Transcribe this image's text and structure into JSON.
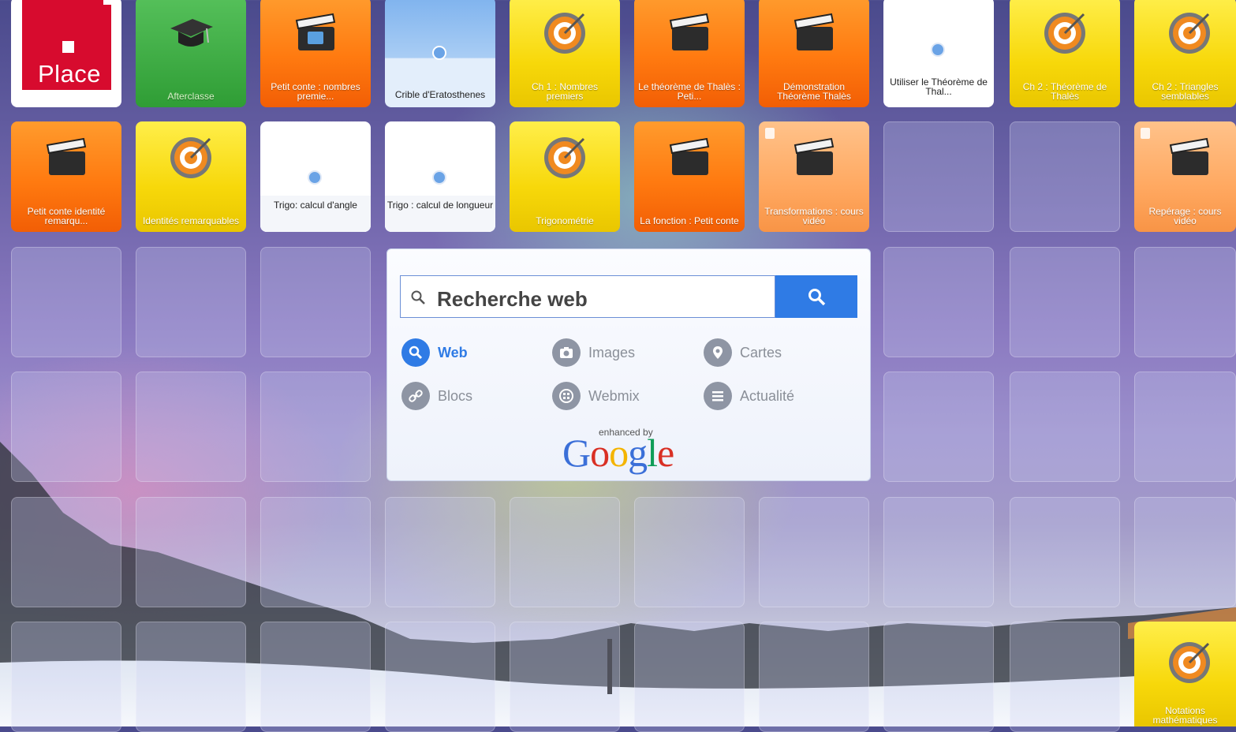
{
  "colors": {
    "accent": "#2f7be5",
    "tile_orange": "#ff7a10",
    "tile_yellow": "#f7d80a",
    "tile_green": "#2f9d35",
    "place_red": "#d70b2e"
  },
  "tiles": {
    "place": {
      "text": "Place",
      "icon": "place-logo"
    },
    "afterclasse": {
      "label": "Afterclasse",
      "icon": "graduation-cap-icon"
    },
    "petit_conte_nombres": {
      "label": "Petit conte : nombres premie...",
      "icon": "clapperboard-icon"
    },
    "crible": {
      "label": "Crible d'Eratosthenes",
      "icon": "globe-icon"
    },
    "ch1_nombres": {
      "label": "Ch 1 : Nombres premiers",
      "icon": "target-icon"
    },
    "theoreme_thales_conte": {
      "label": "Le théorème de Thalès : Peti...",
      "icon": "clapperboard-icon"
    },
    "demonstration_thales": {
      "label": "Démonstration Théorème Thalès",
      "icon": "clapperboard-icon"
    },
    "utiliser_thales": {
      "label": "Utiliser le Théorème de Thal...",
      "icon": "globe-icon"
    },
    "ch2_thales": {
      "label": "Ch 2 : Théorème de Thalès",
      "icon": "target-icon"
    },
    "ch2_triangles": {
      "label": "Ch 2 : Triangles semblables",
      "icon": "target-icon"
    },
    "petit_conte_identite": {
      "label": "Petit conte identité remarqu...",
      "icon": "clapperboard-icon"
    },
    "identites": {
      "label": "Identités remarquables",
      "icon": "target-icon"
    },
    "trigo_angle": {
      "label": "Trigo: calcul d'angle",
      "icon": "globe-icon"
    },
    "trigo_longueur": {
      "label": "Trigo : calcul de longueur",
      "icon": "globe-icon"
    },
    "trigonometrie": {
      "label": "Trigonométrie",
      "icon": "target-icon"
    },
    "fonction_conte": {
      "label": "La fonction : Petit conte",
      "icon": "clapperboard-icon"
    },
    "transformations": {
      "label": "Transformations : cours vidéo",
      "icon": "clapperboard-icon"
    },
    "reperage": {
      "label": "Repérage : cours vidéo",
      "icon": "clapperboard-icon"
    },
    "notations": {
      "label": "Notations mathématiques",
      "icon": "target-icon"
    }
  },
  "search": {
    "placeholder": "Recherche web",
    "options": {
      "web": "Web",
      "images": "Images",
      "cartes": "Cartes",
      "blocs": "Blocs",
      "webmix": "Webmix",
      "actualite": "Actualité"
    },
    "active_option": "web",
    "powered_small": "enhanced by",
    "powered_brand": "Google"
  }
}
